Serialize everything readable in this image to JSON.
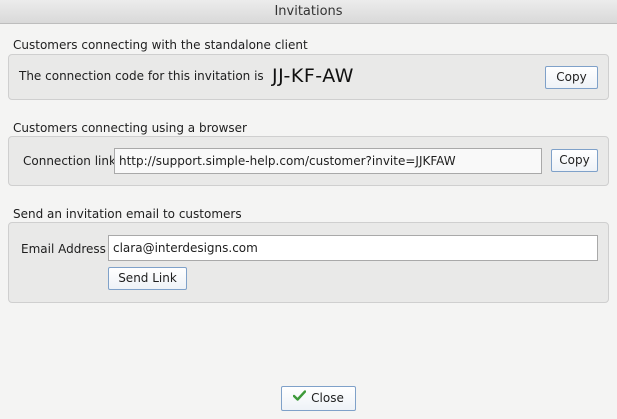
{
  "window": {
    "title": "Invitations"
  },
  "standalone": {
    "section_label": "Customers connecting with the standalone client",
    "description": "The connection code for this invitation is",
    "code": "JJ-KF-AW",
    "copy_label": "Copy"
  },
  "browser": {
    "section_label": "Customers connecting using a browser",
    "field_label": "Connection link",
    "link_value": "http://support.simple-help.com/customer?invite=JJKFAW",
    "copy_label": "Copy"
  },
  "email": {
    "section_label": "Send an invitation email to customers",
    "field_label": "Email Address",
    "value": "clara@interdesigns.com",
    "send_label": "Send Link"
  },
  "footer": {
    "close_label": "Close",
    "close_icon": "checkmark-icon",
    "close_icon_color": "#3e9a3a"
  }
}
